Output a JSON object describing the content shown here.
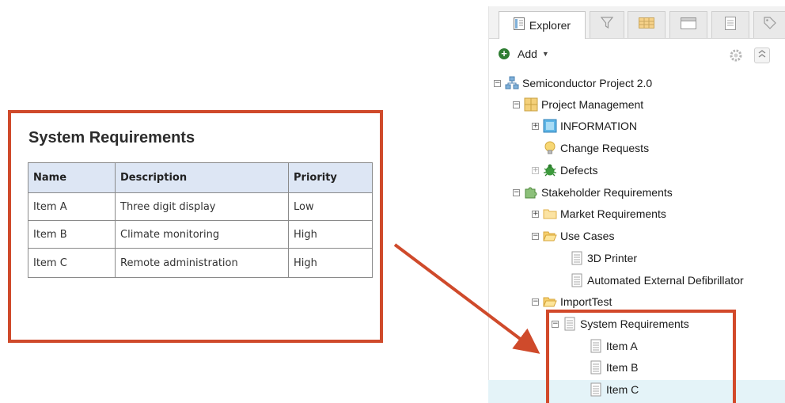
{
  "document": {
    "title": "System Requirements",
    "columns": [
      "Name",
      "Description",
      "Priority"
    ],
    "rows": [
      [
        "Item A",
        "Three digit display",
        "Low"
      ],
      [
        "Item B",
        "Climate monitoring",
        "High"
      ],
      [
        "Item C",
        "Remote administration",
        "High"
      ]
    ]
  },
  "explorer": {
    "tabs": [
      {
        "label": "Explorer",
        "icon": "explorer-tab-icon"
      },
      {
        "label": "",
        "icon": "filter-icon"
      },
      {
        "label": "",
        "icon": "grid-view-icon"
      },
      {
        "label": "",
        "icon": "window-icon"
      },
      {
        "label": "",
        "icon": "document-icon"
      },
      {
        "label": "",
        "icon": "tag-icon"
      }
    ],
    "toolbar": {
      "add_label": "Add",
      "add_icon": "add-circle-icon",
      "caret_icon": "caret-down-icon",
      "settings_icon": "settings-gear-icon",
      "collapse_icon": "collapse-icon"
    },
    "tree": [
      {
        "label": "Semiconductor Project 2.0",
        "icon": "project-icon",
        "expander": "−"
      },
      {
        "label": "Project Management",
        "icon": "folder-grid-icon",
        "expander": "−"
      },
      {
        "label": "INFORMATION",
        "icon": "information-icon",
        "expander": "+"
      },
      {
        "label": "Change Requests",
        "icon": "lightbulb-icon",
        "expander": ""
      },
      {
        "label": "Defects",
        "icon": "bug-icon",
        "expander": "+"
      },
      {
        "label": "Stakeholder Requirements",
        "icon": "puzzle-icon",
        "expander": "−"
      },
      {
        "label": "Market Requirements",
        "icon": "folder-icon",
        "expander": "+"
      },
      {
        "label": "Use Cases",
        "icon": "folder-open-icon",
        "expander": "−"
      },
      {
        "label": "3D Printer",
        "icon": "doc-icon",
        "expander": ""
      },
      {
        "label": "Automated External Defibrillator",
        "icon": "doc-icon",
        "expander": ""
      },
      {
        "label": "ImportTest",
        "icon": "folder-open-icon",
        "expander": "−"
      },
      {
        "label": "System Requirements",
        "icon": "doc-icon",
        "expander": "−"
      },
      {
        "label": "Item A",
        "icon": "doc-icon",
        "expander": ""
      },
      {
        "label": "Item B",
        "icon": "doc-icon",
        "expander": ""
      },
      {
        "label": "Item C",
        "icon": "doc-icon",
        "expander": ""
      }
    ]
  },
  "colors": {
    "highlight_red": "#cf4a2b",
    "table_header_bg": "#dde6f4",
    "selected_row_bg": "#e4f3f8"
  }
}
